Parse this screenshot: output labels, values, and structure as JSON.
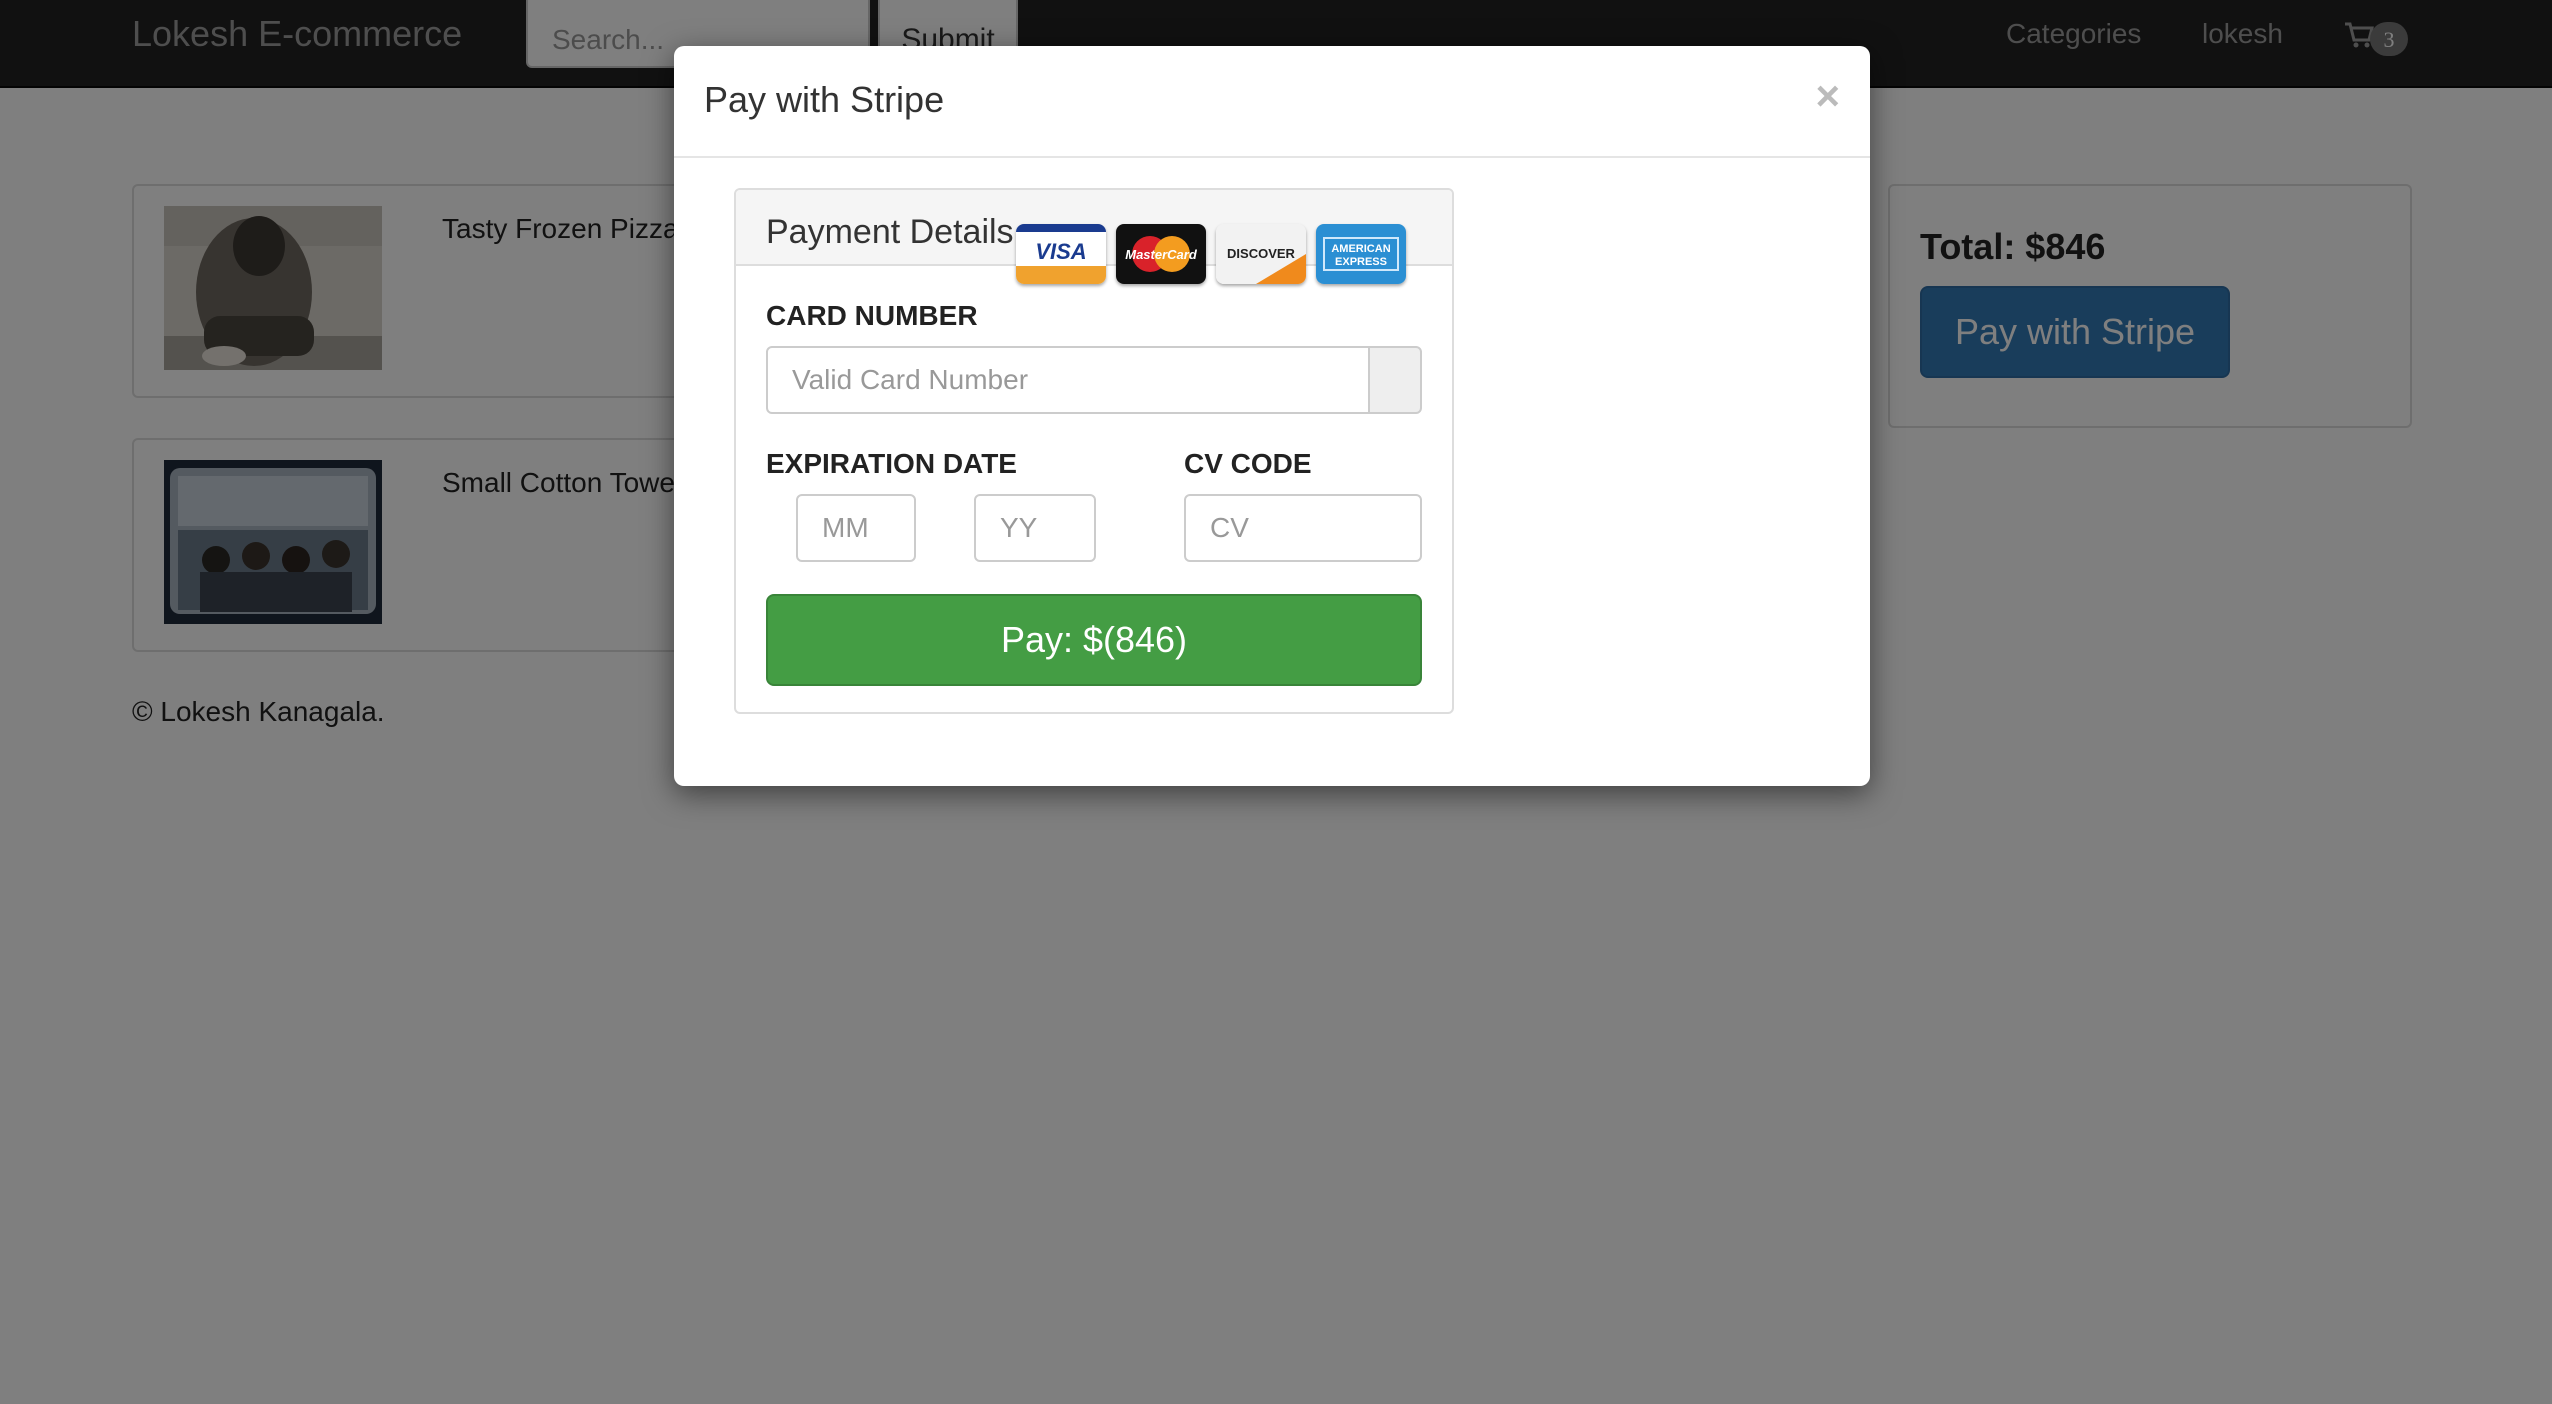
{
  "navbar": {
    "brand": "Lokesh E-commerce",
    "search_placeholder": "Search...",
    "submit_label": "Submit",
    "categories_label": "Categories",
    "user_label": "lokesh",
    "cart_count": "3",
    "cart_icon": "shopping-cart-icon"
  },
  "products": [
    {
      "name": "Tasty Frozen Pizza",
      "thumb_icon": "product-photo"
    },
    {
      "name": "Small Cotton Towels",
      "thumb_icon": "product-photo"
    }
  ],
  "summary": {
    "total": "Total: $846",
    "pay_button": "Pay with Stripe"
  },
  "footer": {
    "text": "© Lokesh Kanagala."
  },
  "modal": {
    "title": "Pay with Stripe",
    "close": "×",
    "panel_title": "Payment Details",
    "card_logos": [
      "VISA",
      "MasterCard",
      "DISCOVER",
      "AMERICAN EXPRESS"
    ],
    "card_number_label": "CARD NUMBER",
    "card_number_placeholder": "Valid Card Number",
    "expiration_label": "EXPIRATION DATE",
    "mm_placeholder": "MM",
    "yy_placeholder": "YY",
    "cv_label": "CV CODE",
    "cv_placeholder": "CV",
    "pay_button": "Pay: $(846)"
  },
  "colors": {
    "navbar": "#222222",
    "primary": "#337ab7",
    "success": "#449d44",
    "backdrop": "rgba(0,0,0,0.5)"
  }
}
